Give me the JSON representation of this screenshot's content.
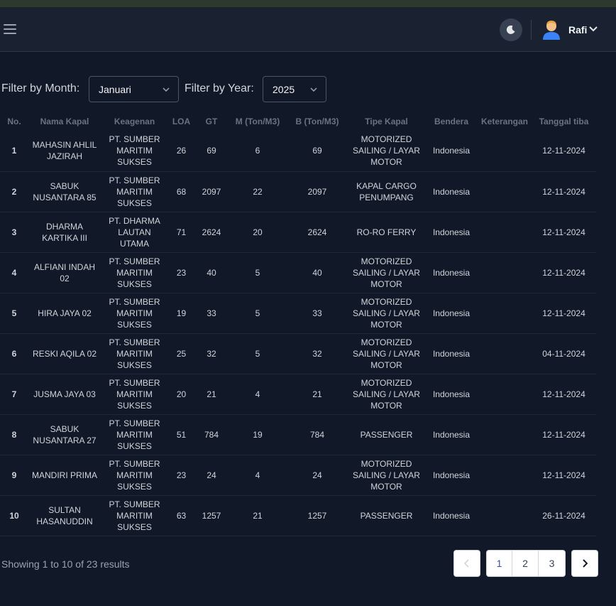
{
  "navbar": {
    "menu_icon": "hamburger-icon",
    "theme_icon": "moon-icon",
    "user_name": "Rafi",
    "dropdown_icon": "chevron-down-icon"
  },
  "filters": {
    "month_label": "Filter by Month:",
    "month_value": "Januari",
    "year_label": "Filter by Year:",
    "year_value": "2025"
  },
  "table": {
    "headers": [
      "No.",
      "Nama Kapal",
      "Keagenan",
      "LOA",
      "GT",
      "M (Ton/M3)",
      "B (Ton/M3)",
      "Tipe Kapal",
      "Bendera",
      "Keterangan",
      "Tanggal tiba"
    ],
    "rows": [
      {
        "no": "1",
        "nama": "MAHASIN AHLIL JAZIRAH",
        "agen": "PT. SUMBER MARITIM SUKSES",
        "loa": "26",
        "gt": "69",
        "m": "6",
        "b": "69",
        "tipe": "MOTORIZED SAILING / LAYAR MOTOR",
        "bendera": "Indonesia",
        "ket": "",
        "tgl": "12-11-2024"
      },
      {
        "no": "2",
        "nama": "SABUK NUSANTARA 85",
        "agen": "PT. SUMBER MARITIM SUKSES",
        "loa": "68",
        "gt": "2097",
        "m": "22",
        "b": "2097",
        "tipe": "KAPAL CARGO PENUMPANG",
        "bendera": "Indonesia",
        "ket": "",
        "tgl": "12-11-2024"
      },
      {
        "no": "3",
        "nama": "DHARMA KARTIKA III",
        "agen": "PT. DHARMA LAUTAN UTAMA",
        "loa": "71",
        "gt": "2624",
        "m": "20",
        "b": "2624",
        "tipe": "RO-RO FERRY",
        "bendera": "Indonesia",
        "ket": "",
        "tgl": "12-11-2024"
      },
      {
        "no": "4",
        "nama": "ALFIANI INDAH 02",
        "agen": "PT. SUMBER MARITIM SUKSES",
        "loa": "23",
        "gt": "40",
        "m": "5",
        "b": "40",
        "tipe": "MOTORIZED SAILING / LAYAR MOTOR",
        "bendera": "Indonesia",
        "ket": "",
        "tgl": "12-11-2024"
      },
      {
        "no": "5",
        "nama": "HIRA JAYA 02",
        "agen": "PT. SUMBER MARITIM SUKSES",
        "loa": "19",
        "gt": "33",
        "m": "5",
        "b": "33",
        "tipe": "MOTORIZED SAILING / LAYAR MOTOR",
        "bendera": "Indonesia",
        "ket": "",
        "tgl": "12-11-2024"
      },
      {
        "no": "6",
        "nama": "RESKI AQILA 02",
        "agen": "PT. SUMBER MARITIM SUKSES",
        "loa": "25",
        "gt": "32",
        "m": "5",
        "b": "32",
        "tipe": "MOTORIZED SAILING / LAYAR MOTOR",
        "bendera": "Indonesia",
        "ket": "",
        "tgl": "04-11-2024"
      },
      {
        "no": "7",
        "nama": "JUSMA JAYA 03",
        "agen": "PT. SUMBER MARITIM SUKSES",
        "loa": "20",
        "gt": "21",
        "m": "4",
        "b": "21",
        "tipe": "MOTORIZED SAILING / LAYAR MOTOR",
        "bendera": "Indonesia",
        "ket": "",
        "tgl": "12-11-2024"
      },
      {
        "no": "8",
        "nama": "SABUK NUSANTARA 27",
        "agen": "PT. SUMBER MARITIM SUKSES",
        "loa": "51",
        "gt": "784",
        "m": "19",
        "b": "784",
        "tipe": "PASSENGER",
        "bendera": "Indonesia",
        "ket": "",
        "tgl": "12-11-2024"
      },
      {
        "no": "9",
        "nama": "MANDIRI PRIMA",
        "agen": "PT. SUMBER MARITIM SUKSES",
        "loa": "23",
        "gt": "24",
        "m": "4",
        "b": "24",
        "tipe": "MOTORIZED SAILING / LAYAR MOTOR",
        "bendera": "Indonesia",
        "ket": "",
        "tgl": "12-11-2024"
      },
      {
        "no": "10",
        "nama": "SULTAN HASANUDDIN",
        "agen": "PT. SUMBER MARITIM SUKSES",
        "loa": "63",
        "gt": "1257",
        "m": "21",
        "b": "1257",
        "tipe": "PASSENGER",
        "bendera": "Indonesia",
        "ket": "",
        "tgl": "26-11-2024"
      }
    ]
  },
  "pagination": {
    "summary": "Showing 1 to 10 of 23 results",
    "pages": [
      "1",
      "2",
      "3"
    ],
    "prev_icon": "chevron-left-icon",
    "next_icon": "chevron-right-icon"
  }
}
